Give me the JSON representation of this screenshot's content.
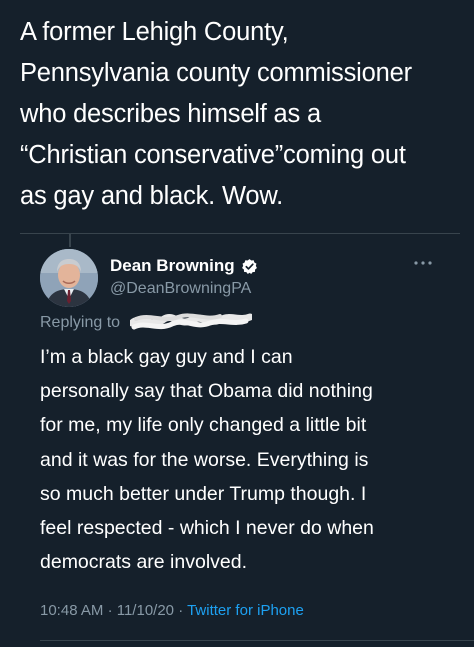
{
  "caption": {
    "lines": [
      "A former Lehigh County,",
      "Pennsylvania county commissioner",
      "who describes himself as a",
      "“Christian conservative”coming out",
      "as gay and black. Wow."
    ]
  },
  "tweet": {
    "author_name": "Dean Browning",
    "handle": "@DeanBrowningPA",
    "verified_icon": "verified-badge-icon",
    "more_icon": "more-options-icon",
    "replying_to_label": "Replying to",
    "text_lines": [
      "I’m a black gay guy and I can",
      "personally say that Obama did nothing",
      "for me, my life only changed a little bit",
      "and it was for the worse. Everything is",
      "so much better under Trump though. I",
      "feel respected - which I never do when",
      "democrats are involved."
    ],
    "time": "10:48 AM",
    "date": "11/10/20",
    "separator": "·",
    "source": "Twitter for iPhone"
  },
  "colors": {
    "background": "#15202b",
    "text": "#ffffff",
    "secondary_text": "#8899a6",
    "link": "#1da1f2",
    "divider": "#38444d"
  }
}
